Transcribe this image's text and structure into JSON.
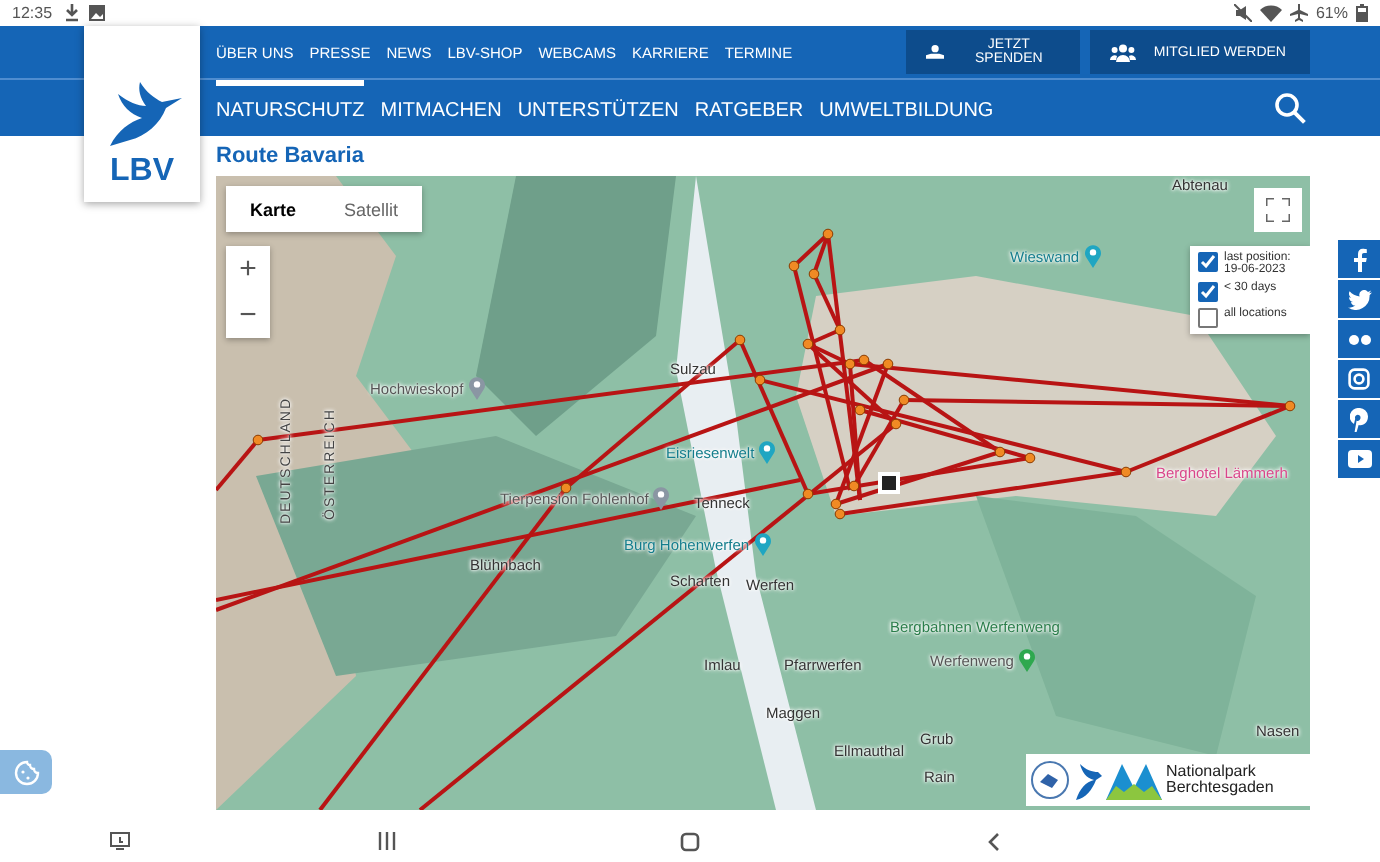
{
  "status_bar": {
    "time": "12:35",
    "battery": "61%"
  },
  "header": {
    "logo": "LBV",
    "top_links": [
      "ÜBER UNS",
      "PRESSE",
      "NEWS",
      "LBV-SHOP",
      "WEBCAMS",
      "KARRIERE",
      "TERMINE"
    ],
    "actions": [
      {
        "label": "JETZT SPENDEN",
        "kind": "donate"
      },
      {
        "label": "MITGLIED WERDEN",
        "kind": "member"
      }
    ],
    "main_nav": [
      {
        "label": "NATURSCHUTZ",
        "selected": true
      },
      {
        "label": "MITMACHEN",
        "selected": false
      },
      {
        "label": "UNTERSTÜTZEN",
        "selected": false
      },
      {
        "label": "RATGEBER",
        "selected": false
      },
      {
        "label": "UMWELTBILDUNG",
        "selected": false
      }
    ]
  },
  "page": {
    "title": "Route Bavaria"
  },
  "map": {
    "map_types": [
      {
        "label": "Karte",
        "selected": true
      },
      {
        "label": "Satellit",
        "selected": false
      }
    ],
    "zoom": [
      "+",
      "−"
    ],
    "legend": [
      {
        "label": "last position:",
        "sub": "19-06-2023",
        "checked": true
      },
      {
        "label": "< 30 days",
        "checked": true
      },
      {
        "label": "all locations",
        "checked": false
      }
    ],
    "places": [
      {
        "label": "Abtenau",
        "kind": "town"
      },
      {
        "label": "Wieswand",
        "kind": "poi"
      },
      {
        "label": "Sulzau",
        "kind": "town"
      },
      {
        "label": "Hochwieskopf",
        "kind": "peak"
      },
      {
        "label": "DEUTSCHLAND",
        "kind": "border"
      },
      {
        "label": "ÖSTERREICH",
        "kind": "border"
      },
      {
        "label": "Eisriesenwelt",
        "kind": "poi"
      },
      {
        "label": "Berghotel Lämmerh",
        "kind": "hotel"
      },
      {
        "label": "Tierpension Fohlenhof",
        "kind": "peak"
      },
      {
        "label": "Tenneck",
        "kind": "town"
      },
      {
        "label": "Burg Hohenwerfen",
        "kind": "poi"
      },
      {
        "label": "Blühnbach",
        "kind": "town"
      },
      {
        "label": "Scharten",
        "kind": "town"
      },
      {
        "label": "Werfen",
        "kind": "town"
      },
      {
        "label": "Bergbahnen Werfenweng",
        "kind": "park"
      },
      {
        "label": "Imlau",
        "kind": "town"
      },
      {
        "label": "Pfarrwerfen",
        "kind": "town"
      },
      {
        "label": "Werfenweng",
        "kind": "lift"
      },
      {
        "label": "Maggen",
        "kind": "town"
      },
      {
        "label": "Nasen",
        "kind": "town"
      },
      {
        "label": "Grub",
        "kind": "town"
      },
      {
        "label": "Ellmauthal",
        "kind": "town"
      },
      {
        "label": "Rain",
        "kind": "town"
      }
    ],
    "partner_logo": "Nationalpark Berchtesgaden"
  }
}
